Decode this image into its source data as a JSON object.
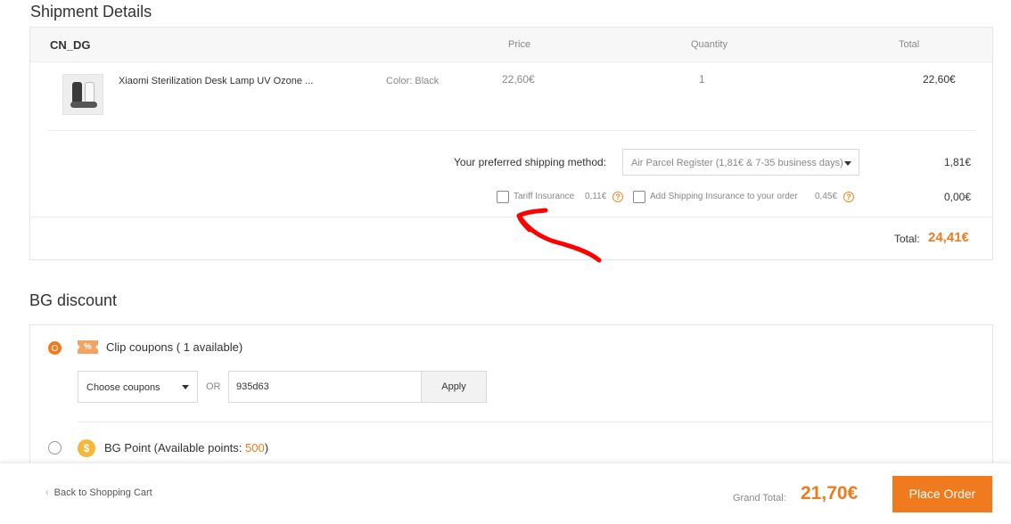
{
  "shipment": {
    "title": "Shipment Details",
    "store": "CN_DG",
    "headers": {
      "price": "Price",
      "quantity": "Quantity",
      "total": "Total"
    },
    "item": {
      "name": "Xiaomi Sterilization Desk Lamp UV Ozone ...",
      "color": "Color: Black",
      "price": "22,60€",
      "quantity": "1",
      "total": "22,60€"
    },
    "shipping": {
      "label": "Your preferred shipping method:",
      "selected": "Air Parcel Register (1,81€ & 7-35 business days)",
      "cost": "1,81€"
    },
    "insurance": {
      "tariff_label": "Tariff Insurance",
      "tariff_price": "0,11€",
      "shipping_label": "Add Shipping Insurance to your order",
      "shipping_price": "0,45€",
      "cost": "0,00€"
    },
    "total_label": "Total:",
    "total_value": "24,41€"
  },
  "discount": {
    "title": "BG discount",
    "clip": {
      "label": "Clip coupons ( 1 available)",
      "icon_text": "%",
      "select_placeholder": "Choose coupons",
      "or": "OR",
      "code": "935d63",
      "apply": "Apply"
    },
    "points": {
      "label": "BG Point (Available points: ",
      "value": "500",
      "close": ")",
      "icon_text": "$"
    }
  },
  "footer": {
    "back": "Back to Shopping Cart",
    "grand_label": "Grand Total:",
    "grand_value": "21,70€",
    "place_order": "Place Order"
  },
  "colors": {
    "accent": "#f07b1e",
    "annotation": "#ff0000"
  }
}
